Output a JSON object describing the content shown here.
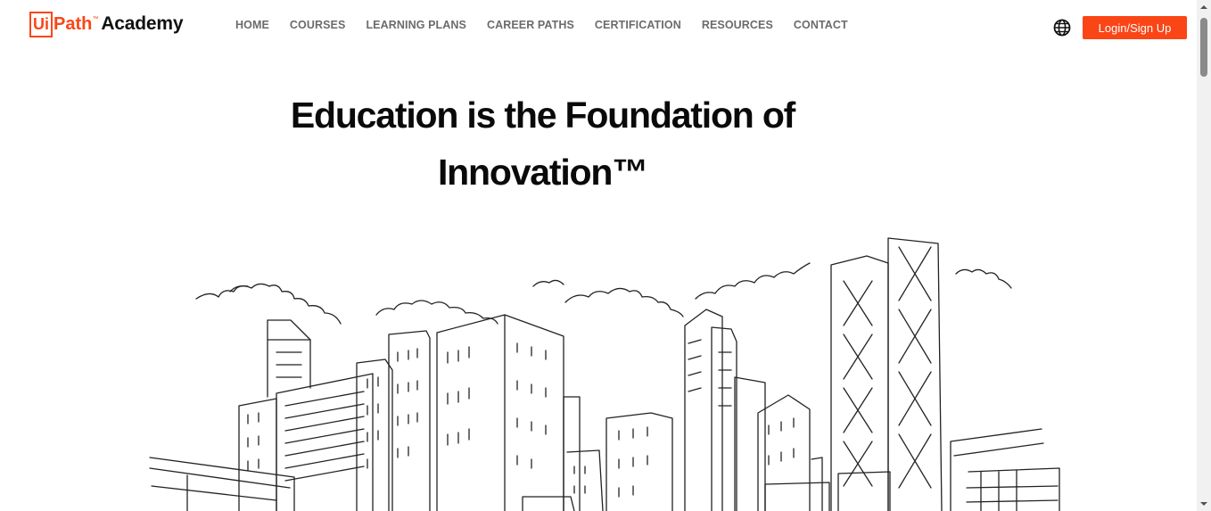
{
  "logo": {
    "box_text": "Ui",
    "rest_text": "Path",
    "tm": "™",
    "academy_text": "Academy"
  },
  "nav": {
    "items": [
      {
        "label": "HOME"
      },
      {
        "label": "COURSES"
      },
      {
        "label": "LEARNING PLANS"
      },
      {
        "label": "CAREER PATHS"
      },
      {
        "label": "CERTIFICATION"
      },
      {
        "label": "RESOURCES"
      },
      {
        "label": "CONTACT"
      }
    ]
  },
  "header": {
    "globe_icon": "globe-icon",
    "login_label": "Login/Sign Up"
  },
  "hero": {
    "title_line1": "Education is the Foundation of",
    "title_line2": "Innovation™"
  },
  "colors": {
    "brand": "#fa4616",
    "nav_text": "#6b6b6b",
    "title_text": "#0a0a0a"
  }
}
